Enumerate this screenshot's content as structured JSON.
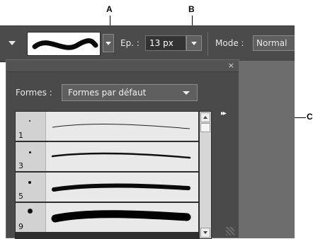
{
  "callouts": {
    "a": "A",
    "b": "B",
    "c": "C"
  },
  "toolbar": {
    "size_label": "Ep. :",
    "size_value": "13 px",
    "mode_label": "Mode :",
    "mode_value": "Normal"
  },
  "panel": {
    "close_glyph": "×",
    "formes_label": "Formes :",
    "formes_value": "Formes par défaut",
    "menu_glyph": "▸▸",
    "brushes": [
      {
        "size": "1"
      },
      {
        "size": "3"
      },
      {
        "size": "5"
      },
      {
        "size": "9"
      }
    ]
  }
}
